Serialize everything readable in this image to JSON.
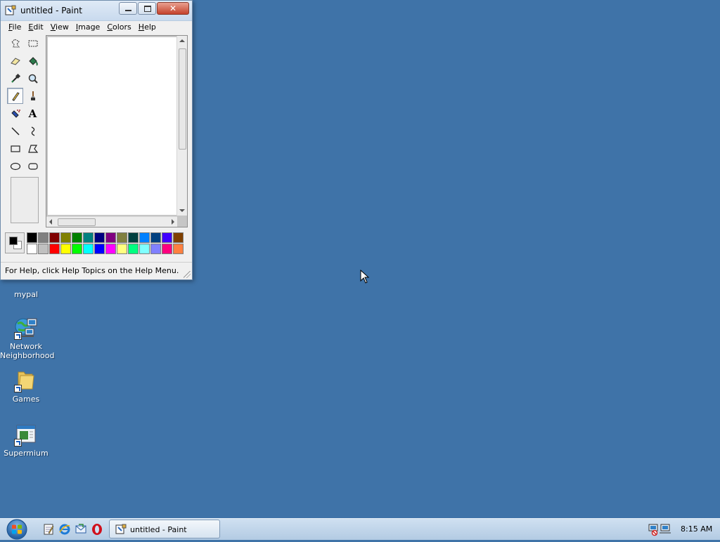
{
  "window": {
    "title": "untitled - Paint",
    "close_glyph": "✕"
  },
  "menu": [
    {
      "accel": "F",
      "rest": "ile"
    },
    {
      "accel": "E",
      "rest": "dit"
    },
    {
      "accel": "V",
      "rest": "iew"
    },
    {
      "accel": "I",
      "rest": "mage"
    },
    {
      "accel": "C",
      "rest": "olors"
    },
    {
      "accel": "H",
      "rest": "elp"
    }
  ],
  "tools": [
    "free-form-select",
    "select",
    "eraser",
    "fill-with-color",
    "pick-color",
    "magnifier",
    "pencil",
    "brush",
    "airbrush",
    "text",
    "line",
    "curve",
    "rectangle",
    "polygon",
    "ellipse",
    "rounded-rectangle"
  ],
  "active_tool": "pencil",
  "text_tool_glyph": "A",
  "colors": {
    "foreground": "#000000",
    "background": "#ffffff",
    "palette_top": [
      "#000000",
      "#808080",
      "#800000",
      "#808000",
      "#008000",
      "#008080",
      "#000080",
      "#800080",
      "#808040",
      "#004040",
      "#0080ff",
      "#004080",
      "#4000ff",
      "#804000"
    ],
    "palette_bottom": [
      "#ffffff",
      "#c0c0c0",
      "#ff0000",
      "#ffff00",
      "#00ff00",
      "#00ffff",
      "#0000ff",
      "#ff00ff",
      "#ffff80",
      "#00ff80",
      "#80ffff",
      "#8080ff",
      "#ff0080",
      "#ff8040"
    ],
    "desktop": "#3f73a8"
  },
  "status": {
    "text": "For Help, click Help Topics on the Help Menu."
  },
  "desktop_icons": [
    {
      "label": "mypal",
      "icon": "mypal-icon"
    },
    {
      "label": "Network\nNeighborhood",
      "line1": "Network",
      "line2": "Neighborhood",
      "icon": "network-neighborhood-icon"
    },
    {
      "label": "Games",
      "icon": "folder-icon"
    },
    {
      "label": "Supermium",
      "icon": "supermium-icon"
    }
  ],
  "taskbar": {
    "quick_launch": [
      "notepad-icon",
      "internet-explorer-icon",
      "outlook-express-icon",
      "opera-icon"
    ],
    "task_label": "untitled - Paint",
    "clock": "8:15 AM"
  }
}
